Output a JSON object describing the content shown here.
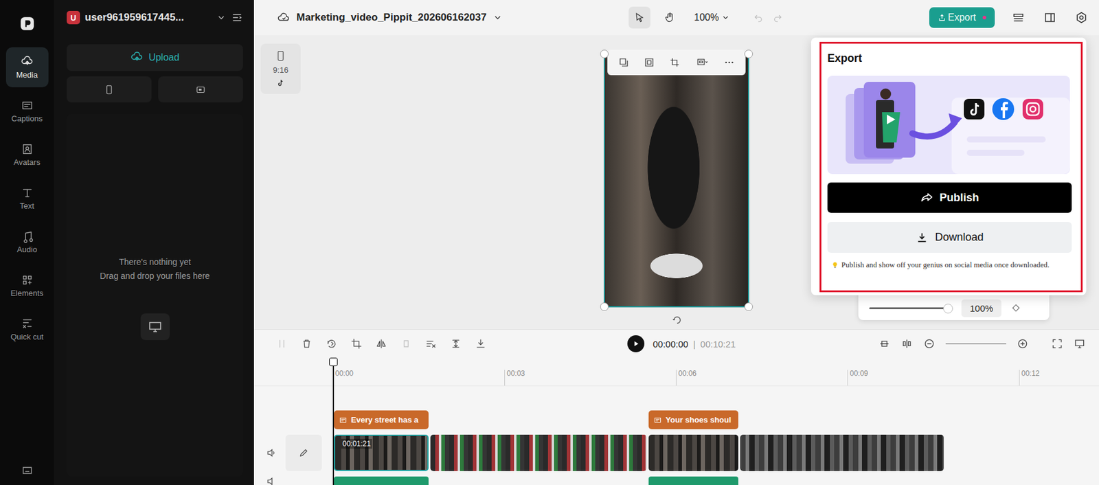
{
  "sidebar": {
    "items": [
      {
        "label": "Media",
        "selected": true
      },
      {
        "label": "Captions",
        "selected": false
      },
      {
        "label": "Avatars",
        "selected": false
      },
      {
        "label": "Text",
        "selected": false
      },
      {
        "label": "Audio",
        "selected": false
      },
      {
        "label": "Elements",
        "selected": false
      },
      {
        "label": "Quick cut",
        "selected": false
      }
    ]
  },
  "account": {
    "initial": "U",
    "name": "user961959617445..."
  },
  "media": {
    "upload": "Upload",
    "empty_title": "There's nothing yet",
    "empty_hint": "Drag and drop your files here"
  },
  "project": {
    "title": "Marketing_video_Pippit_202606162037"
  },
  "toolbar": {
    "zoom": "100%",
    "export": "Export"
  },
  "canvas": {
    "aspect": "9:16"
  },
  "export_popup": {
    "title": "Export",
    "publish": "Publish",
    "download": "Download",
    "hint": "Publish and show off your genius on social media once downloaded."
  },
  "zoom_panel": {
    "level": 0.95,
    "reading": "100%"
  },
  "playback": {
    "current": "00:00:00",
    "separator": "|",
    "total": "00:10:21"
  },
  "ruler": [
    "00:00",
    "00:03",
    "00:06",
    "00:09",
    "00:12"
  ],
  "captions": [
    {
      "text": "Every street has a"
    },
    {
      "text": "Your shoes shoul"
    }
  ],
  "clips": [
    {
      "selected": true,
      "label": "00:01:21"
    },
    {
      "selected": false
    },
    {
      "selected": false
    },
    {
      "selected": false
    }
  ]
}
